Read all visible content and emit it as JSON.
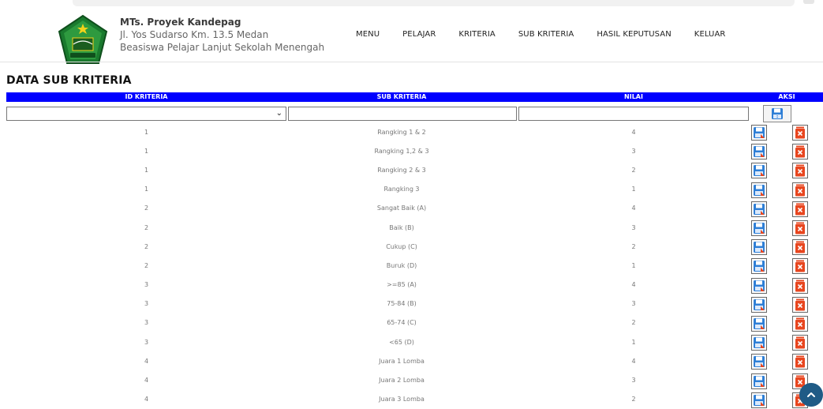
{
  "brand": {
    "name": "MTs. Proyek Kandepag",
    "address": "Jl. Yos Sudarso Km. 13.5 Medan",
    "tagline": "Beasiswa Pelajar Lanjut Sekolah Menengah"
  },
  "nav": [
    "MENU",
    "PELAJAR",
    "KRITERIA",
    "SUB KRITERIA",
    "HASIL KEPUTUSAN",
    "KELUAR"
  ],
  "page_title": "DATA SUB KRITERIA",
  "table": {
    "headers": [
      "ID KRITERIA",
      "SUB KRITERIA",
      "NILAI",
      "AKSI"
    ],
    "filter": {
      "id_kriteria": "",
      "sub_kriteria": "",
      "nilai": ""
    },
    "rows": [
      {
        "id": "1",
        "sub": "Rangking 1 & 2",
        "nilai": "4"
      },
      {
        "id": "1",
        "sub": "Rangking 1,2 & 3",
        "nilai": "3"
      },
      {
        "id": "1",
        "sub": "Rangking 2 & 3",
        "nilai": "2"
      },
      {
        "id": "1",
        "sub": "Rangking 3",
        "nilai": "1"
      },
      {
        "id": "2",
        "sub": "Sangat Baik (A)",
        "nilai": "4"
      },
      {
        "id": "2",
        "sub": "Baik (B)",
        "nilai": "3"
      },
      {
        "id": "2",
        "sub": "Cukup (C)",
        "nilai": "2"
      },
      {
        "id": "2",
        "sub": "Buruk (D)",
        "nilai": "1"
      },
      {
        "id": "3",
        "sub": ">=85 (A)",
        "nilai": "4"
      },
      {
        "id": "3",
        "sub": "75-84 (B)",
        "nilai": "3"
      },
      {
        "id": "3",
        "sub": "65-74 (C)",
        "nilai": "2"
      },
      {
        "id": "3",
        "sub": "<65 (D)",
        "nilai": "1"
      },
      {
        "id": "4",
        "sub": "Juara 1 Lomba",
        "nilai": "4"
      },
      {
        "id": "4",
        "sub": "Juara 2 Lomba",
        "nilai": "3"
      },
      {
        "id": "4",
        "sub": "Juara 3 Lomba",
        "nilai": "2"
      }
    ]
  },
  "colors": {
    "header_bg": "#0000ff",
    "delete": "#e8461f",
    "save": "#2f7fd6",
    "fab": "#1f5b86"
  },
  "icons": {
    "save": "floppy-disk-icon",
    "delete": "trash-delete-icon",
    "scroll_top": "chevron-up-icon"
  }
}
